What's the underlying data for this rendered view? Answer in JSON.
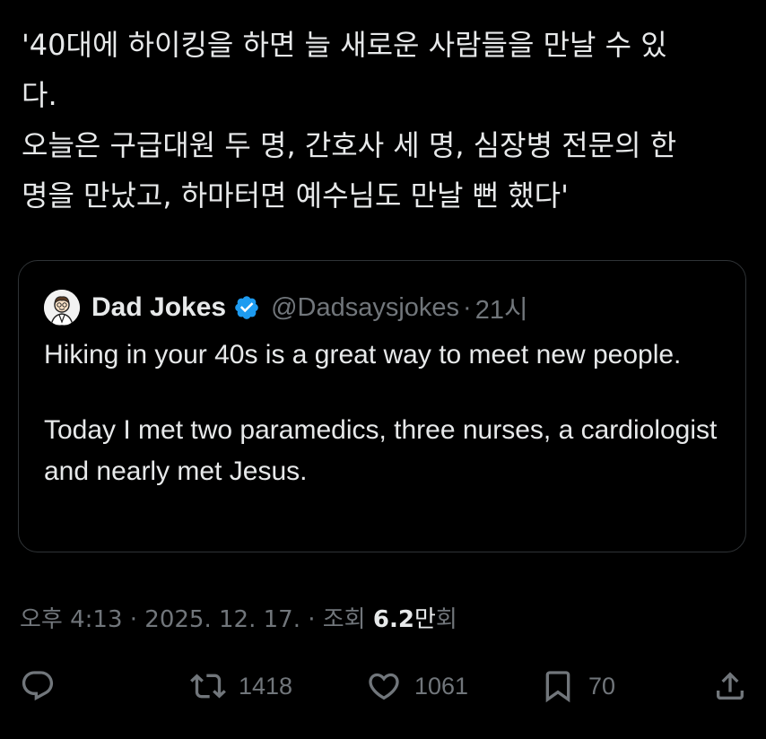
{
  "tweet": {
    "text_lines": [
      "'40대에 하이킹을 하면 늘 새로운 사람들을 만날 수 있",
      "다.",
      "오늘은 구급대원 두 명, 간호사 세 명, 심장병 전문의 한",
      "명을 만났고, 하마터면 예수님도 만날 뻔 했다'"
    ]
  },
  "quote": {
    "avatar_icon": "dad-cartoon-avatar-icon",
    "name": "Dad Jokes",
    "verified_icon": "verified-badge-icon",
    "verified_color": "#1d9bf0",
    "handle": "@Dadsaysjokes",
    "separator": "·",
    "time": "21시",
    "body_paragraph_1": "Hiking in your 40s is a great way to meet new people.",
    "body_paragraph_2": "Today I met two paramedics, three nurses, a cardiologist and nearly met Jesus."
  },
  "meta": {
    "time": "오후 4:13",
    "separator_1": " · ",
    "date": "2025. 12. 17.",
    "separator_2": " · ",
    "views_label": "조회 ",
    "views_count": "6.2",
    "views_unit": "만",
    "views_suffix": "회"
  },
  "actions": {
    "reply": {
      "icon": "reply-icon",
      "count": ""
    },
    "retweet": {
      "icon": "retweet-icon",
      "count": "1418"
    },
    "like": {
      "icon": "heart-icon",
      "count": "1061"
    },
    "bookmark": {
      "icon": "bookmark-icon",
      "count": "70"
    },
    "share": {
      "icon": "share-icon",
      "count": ""
    }
  },
  "colors": {
    "background": "#000000",
    "text": "#e7e9ea",
    "secondary_text": "#71767b",
    "border": "#2f3336"
  }
}
